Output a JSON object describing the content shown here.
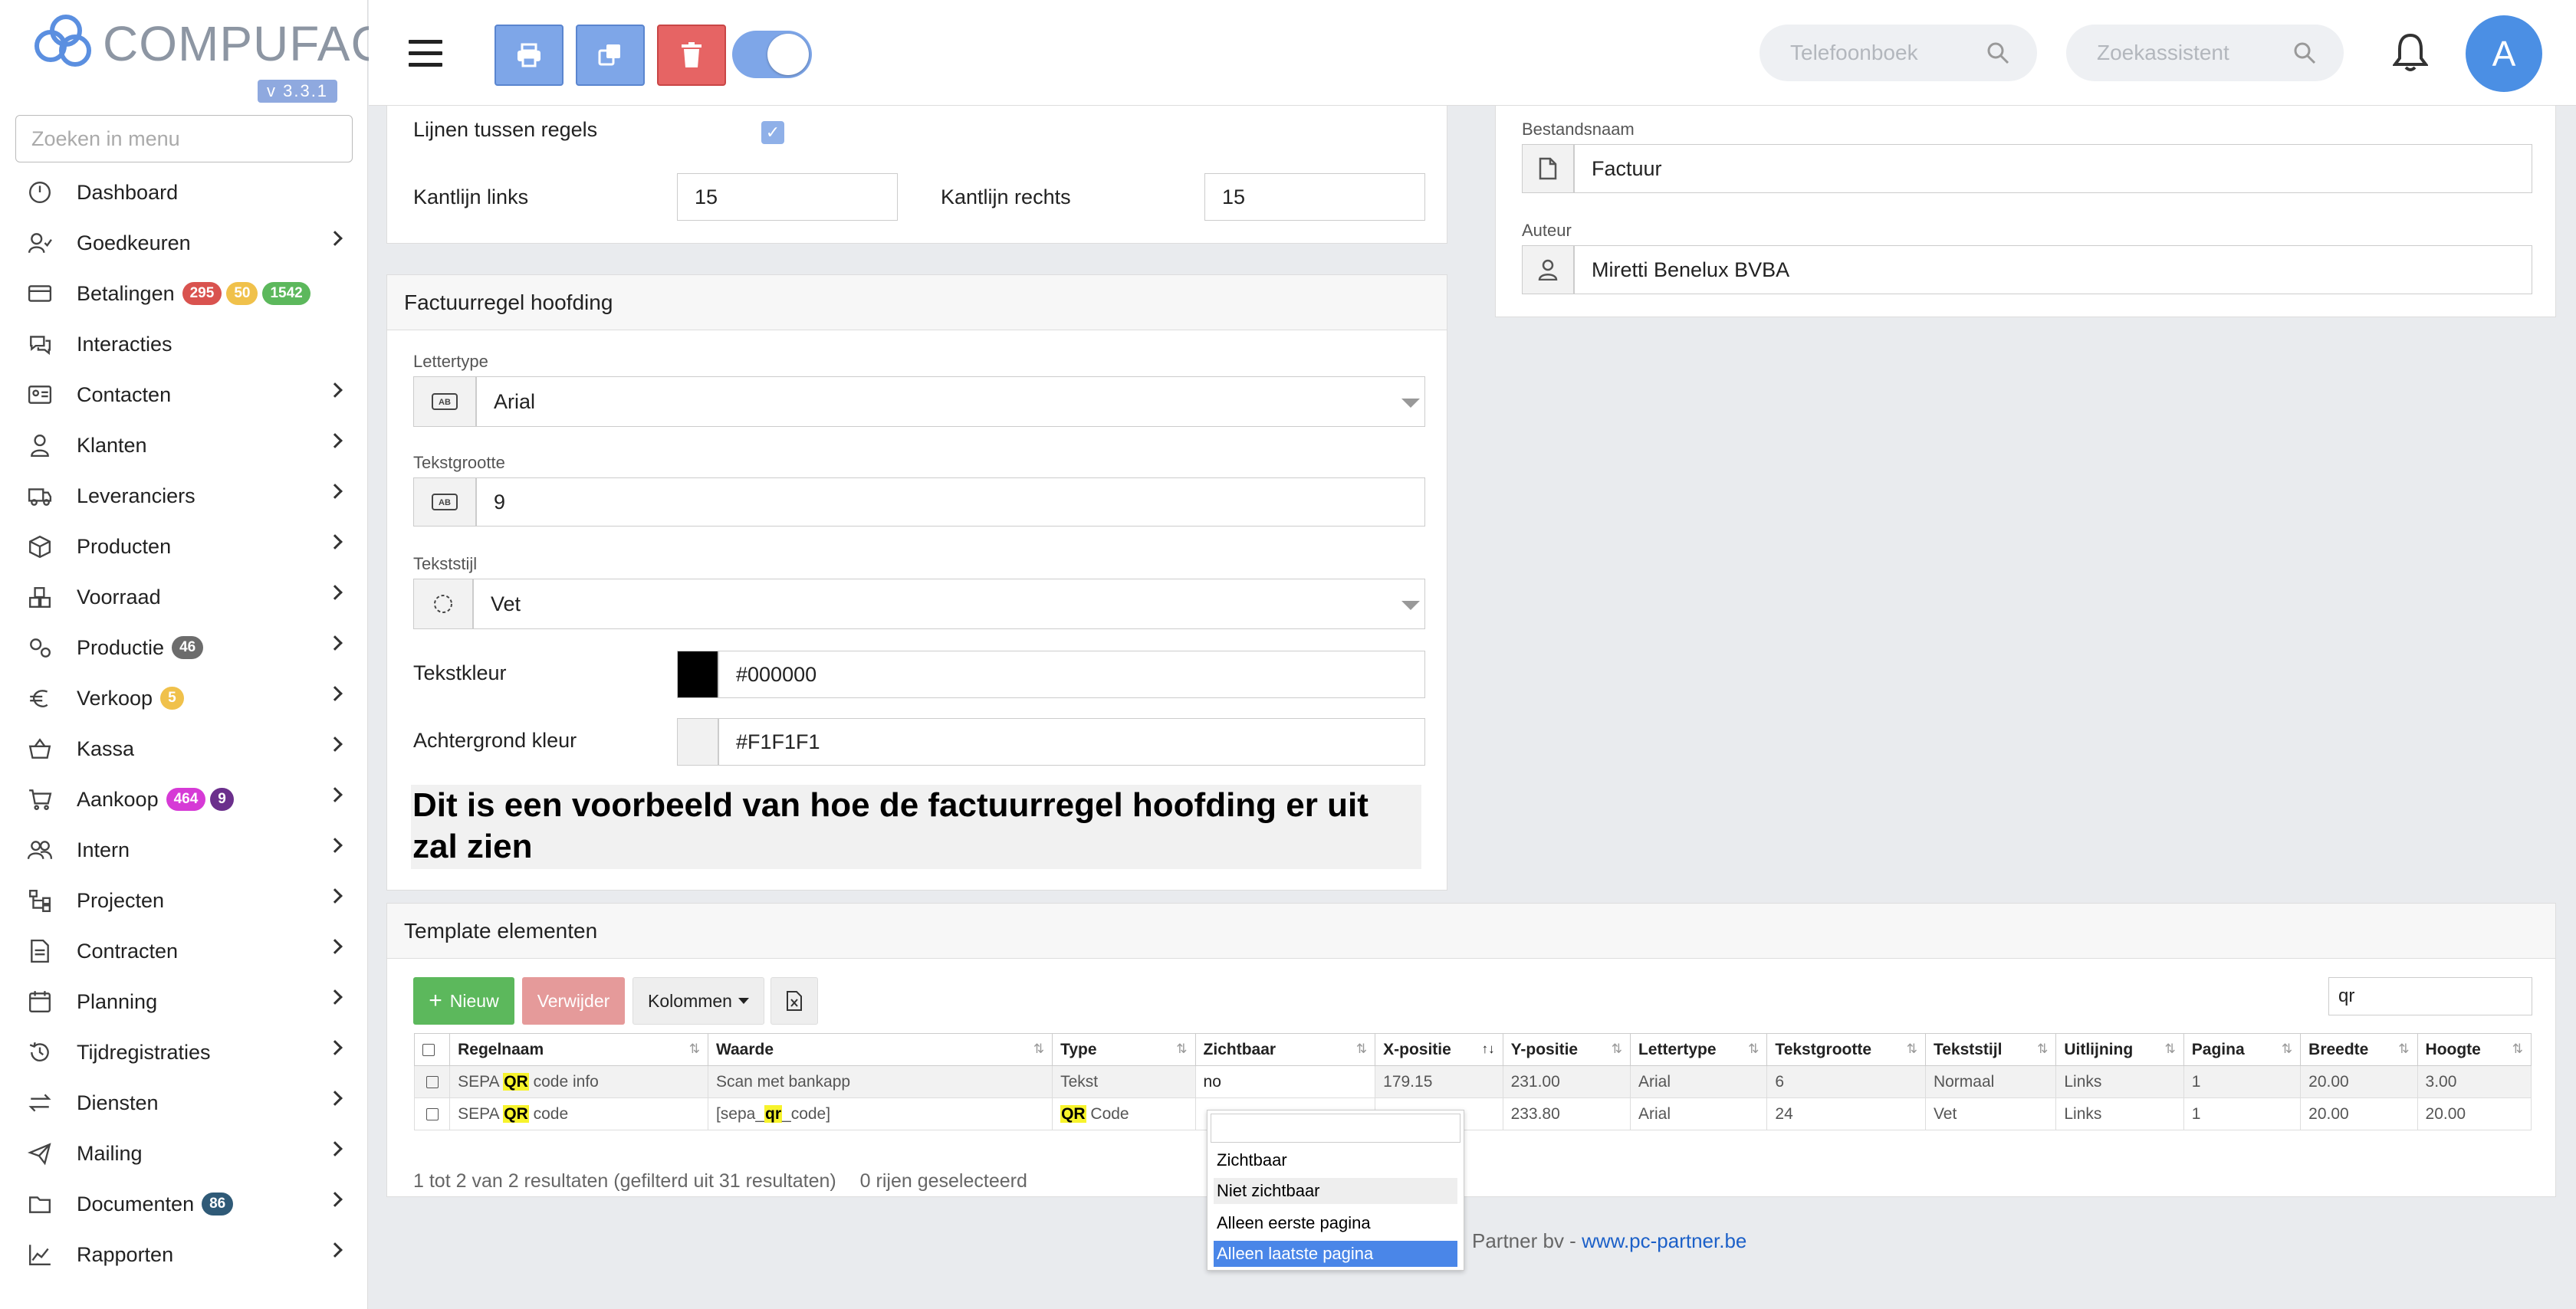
{
  "app": {
    "brand": "COMPUFACT",
    "version": "v 3.3.1"
  },
  "sidebar": {
    "search_placeholder": "Zoeken in menu",
    "items": [
      {
        "label": "Dashboard",
        "icon": "dashboard-icon",
        "chevron": false
      },
      {
        "label": "Goedkeuren",
        "icon": "user-check-icon",
        "chevron": true
      },
      {
        "label": "Betalingen",
        "icon": "credit-card-icon",
        "chevron": false,
        "badges": [
          {
            "text": "295",
            "color": "#d9534f"
          },
          {
            "text": "50",
            "color": "#f0c14b"
          },
          {
            "text": "1542",
            "color": "#5cb85c"
          }
        ]
      },
      {
        "label": "Interacties",
        "icon": "chat-icon",
        "chevron": false
      },
      {
        "label": "Contacten",
        "icon": "contact-card-icon",
        "chevron": true
      },
      {
        "label": "Klanten",
        "icon": "customer-icon",
        "chevron": true
      },
      {
        "label": "Leveranciers",
        "icon": "truck-icon",
        "chevron": true
      },
      {
        "label": "Producten",
        "icon": "box-icon",
        "chevron": true
      },
      {
        "label": "Voorraad",
        "icon": "boxes-icon",
        "chevron": true
      },
      {
        "label": "Productie",
        "icon": "cogs-icon",
        "chevron": true,
        "badges": [
          {
            "text": "46",
            "color": "#6c6c6c"
          }
        ]
      },
      {
        "label": "Verkoop",
        "icon": "euro-icon",
        "chevron": true,
        "badges": [
          {
            "text": "5",
            "color": "#f0c14b"
          }
        ]
      },
      {
        "label": "Kassa",
        "icon": "basket-icon",
        "chevron": true
      },
      {
        "label": "Aankoop",
        "icon": "cart-icon",
        "chevron": true,
        "badges": [
          {
            "text": "464",
            "color": "#d63ad6"
          },
          {
            "text": "9",
            "color": "#6b2f8c"
          }
        ]
      },
      {
        "label": "Intern",
        "icon": "users-icon",
        "chevron": true
      },
      {
        "label": "Projecten",
        "icon": "sitemap-icon",
        "chevron": true
      },
      {
        "label": "Contracten",
        "icon": "contract-icon",
        "chevron": true
      },
      {
        "label": "Planning",
        "icon": "calendar-icon",
        "chevron": true
      },
      {
        "label": "Tijdregistraties",
        "icon": "history-icon",
        "chevron": true
      },
      {
        "label": "Diensten",
        "icon": "exchange-icon",
        "chevron": true
      },
      {
        "label": "Mailing",
        "icon": "paper-plane-icon",
        "chevron": true
      },
      {
        "label": "Documenten",
        "icon": "folder-icon",
        "chevron": true,
        "badges": [
          {
            "text": "86",
            "color": "#2f5a77"
          }
        ]
      },
      {
        "label": "Rapporten",
        "icon": "line-chart-icon",
        "chevron": true
      }
    ]
  },
  "topbar": {
    "phonebook_placeholder": "Telefoonboek",
    "assistant_placeholder": "Zoekassistent",
    "avatar_letter": "A"
  },
  "layout_panel": {
    "lines_label": "Lijnen tussen regels",
    "lines_checked": true,
    "margin_left_label": "Kantlijn links",
    "margin_left_value": "15",
    "margin_right_label": "Kantlijn rechts",
    "margin_right_value": "15"
  },
  "heading_panel": {
    "title": "Factuurregel hoofding",
    "font_label": "Lettertype",
    "font_value": "Arial",
    "size_label": "Tekstgrootte",
    "size_value": "9",
    "style_label": "Tekststijl",
    "style_value": "Vet",
    "color_label": "Tekstkleur",
    "color_value": "#000000",
    "bg_label": "Achtergrond kleur",
    "bg_value": "#F1F1F1",
    "preview_text": "Dit is een voorbeeld van hoe de factuurregel hoofding er uit zal zien"
  },
  "file_panel": {
    "filename_label": "Bestandsnaam",
    "filename_value": "Factuur",
    "author_label": "Auteur",
    "author_value": "Miretti Benelux BVBA"
  },
  "template_panel": {
    "title": "Template elementen",
    "new_label": "Nieuw",
    "delete_label": "Verwijder",
    "columns_label": "Kolommen",
    "search_value": "qr",
    "headers": [
      "Regelnaam",
      "Waarde",
      "Type",
      "Zichtbaar",
      "X-positie",
      "Y-positie",
      "Lettertype",
      "Tekstgrootte",
      "Tekststijl",
      "Uitlijning",
      "Pagina",
      "Breedte",
      "Hoogte"
    ],
    "rows": [
      {
        "name_pre": "SEPA ",
        "name_hl": "QR",
        "name_post": " code info",
        "value_pre": "Scan met bankapp",
        "value_hl": "",
        "value_post": "",
        "type_hl": "",
        "type_post": "Tekst",
        "visible": "no",
        "x": "179.15",
        "y": "231.00",
        "font": "Arial",
        "size": "6",
        "style": "Normaal",
        "align": "Links",
        "page": "1",
        "width": "20.00",
        "height": "3.00"
      },
      {
        "name_pre": "SEPA ",
        "name_hl": "QR",
        "name_post": " code",
        "value_pre": "[sepa_",
        "value_hl": "qr",
        "value_post": "_code]",
        "type_hl": "QR",
        "type_post": " Code",
        "visible": "",
        "x": "",
        "y": "233.80",
        "font": "Arial",
        "size": "24",
        "style": "Vet",
        "align": "Links",
        "page": "1",
        "width": "20.00",
        "height": "20.00"
      }
    ],
    "info_text": "1 tot 2 van 2 resultaten (gefilterd uit 31 resultaten)",
    "selected_text": "0 rijen geselecteerd",
    "dropdown_options": [
      "Zichtbaar",
      "Niet zichtbaar",
      "Alleen eerste pagina",
      "Alleen laatste pagina"
    ]
  },
  "footer": {
    "text": "Partner bv - ",
    "link": "www.pc-partner.be"
  }
}
